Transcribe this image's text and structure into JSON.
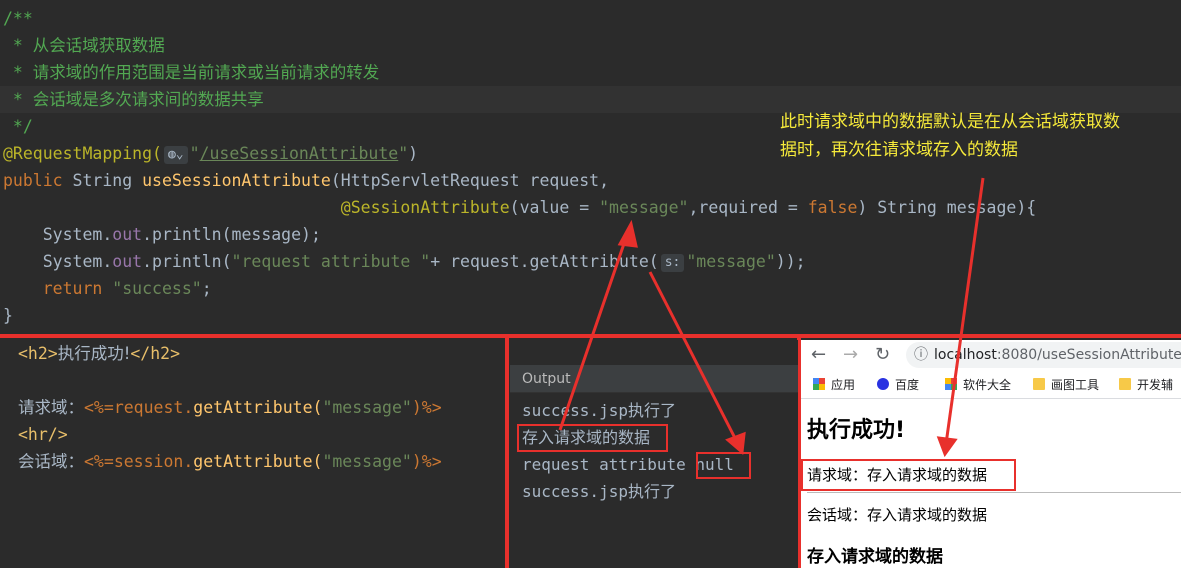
{
  "code": {
    "l1": "/**",
    "l2": " * 从会话域获取数据",
    "l3": " * 请求域的作用范围是当前请求或当前请求的转发",
    "l4": " * 会话域是多次请求间的数据共享",
    "l5": " */",
    "ann": "@RequestMapping(",
    "map_quote_open": "\"",
    "map_url": "/useSessionAttribute",
    "map_quote_close": "\"",
    "map_close": ")",
    "pub": "public",
    "strtype": " String ",
    "method": "useSessionAttribute",
    "params1": "(HttpServletRequest ",
    "req": "request",
    "comma": ",",
    "indent2": "                                  ",
    "sess_ann": "@SessionAttribute",
    "sess_open": "(",
    "value_kw": "value",
    "eq": " = ",
    "message_str": "\"message\"",
    "required_kw": ",required",
    "eq2": " = ",
    "false_kw": "false",
    "sess_tail": ") String ",
    "msg_param": "message",
    "sess_end": "){",
    "indent1": "    ",
    "sys": "System.",
    "out": "out",
    "println_open": ".println(message);",
    "sys2": "System.",
    "out2": "out",
    "println2": ".println(",
    "req_attr_str": "\"request attribute \"",
    "plus": "+ ",
    "req2": "request",
    "get_attr": ".getAttribute(",
    "hint_s": "s:",
    "message_str2": "\"message\"",
    "close2": "));",
    "return_kw": "return",
    "success_str": " \"success\"",
    "semi": ";",
    "brace": "}"
  },
  "note": {
    "line1": "此时请求域中的数据默认是在从会话域获取数",
    "line2": "据时，再次往请求域存入的数据"
  },
  "jsp": {
    "h2_open": "<h2>",
    "h2_text": "执行成功!",
    "h2_close": "</h2>",
    "req_label": "请求域：",
    "req_expr_open": "<%=",
    "req_expr": "request.",
    "req_method": "getAttribute(",
    "req_arg": "\"message\"",
    "req_expr_close": ")%>",
    "hr": "<hr/>",
    "sess_label": "会话域：",
    "sess_expr_open": "<%=",
    "sess_expr": "session.",
    "sess_method": "getAttribute(",
    "sess_arg": "\"message\"",
    "sess_expr_close": ")%>"
  },
  "output": {
    "title": "Output",
    "line1": "success.jsp执行了",
    "line2": "存入请求域的数据",
    "line3_prefix": "request attribute ",
    "line3_value": "null",
    "line4": "success.jsp执行了"
  },
  "browser": {
    "url_host": "localhost",
    "url_path": ":8080/useSessionAttribute",
    "bookmarks": [
      "应用",
      "百度",
      "软件大全",
      "画图工具",
      "开发辅"
    ],
    "h2": "执行成功!",
    "req_line": "请求域：存入请求域的数据",
    "sess_line": "会话域：存入请求域的数据",
    "h3": "存入请求域的数据"
  },
  "colors": {
    "accent_red": "#e8302c",
    "note_yellow": "#f5e93a"
  }
}
